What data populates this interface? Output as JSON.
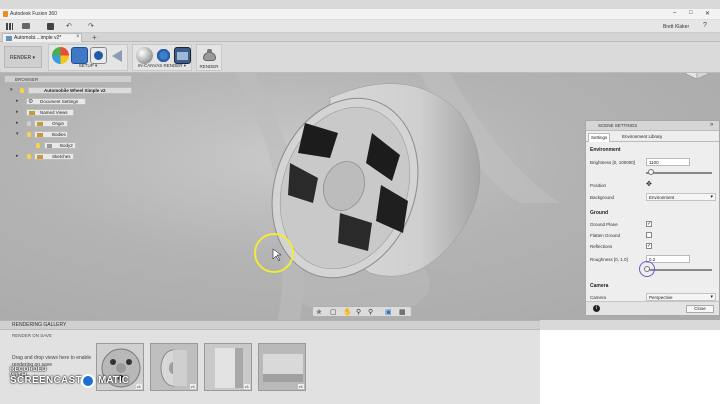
{
  "window": {
    "title": "Autodesk Fusion 360",
    "controls": [
      "–",
      "□",
      "✕"
    ]
  },
  "qat": {
    "grid_icon": "grid-icon",
    "user": "Brett Klaker",
    "help": "?"
  },
  "doc_tab": {
    "label": "Automobi....imple v2*",
    "close": "×",
    "new": "+"
  },
  "toolbar": {
    "mode_label": "RENDER ▾",
    "setup_label": "SETUP ▾",
    "in_canvas_label": "IN-CANVAS RENDER ▾",
    "render_label": "RENDER"
  },
  "browser": {
    "title": "BROWSER",
    "items": [
      {
        "label": "Automobile Wheel Simple v2",
        "level": 0
      },
      {
        "label": "Document Settings",
        "level": 1
      },
      {
        "label": "Named Views",
        "level": 1
      },
      {
        "label": "Origin",
        "level": 1
      },
      {
        "label": "Bodies",
        "level": 1
      },
      {
        "label": "Body2",
        "level": 2
      },
      {
        "label": "Sketches",
        "level": 1
      }
    ]
  },
  "scene_settings": {
    "title": "SCENE SETTINGS",
    "tabs": [
      "Settings",
      "Environment Library"
    ],
    "environment": {
      "section": "Environment",
      "brightness_label": "Brightness [0, 100000]",
      "brightness_value": "1100",
      "brightness_level": 0.05,
      "position_label": "Position",
      "background_label": "Background",
      "background_value": "Environment"
    },
    "ground": {
      "section": "Ground",
      "ground_plane_label": "Ground Plane",
      "ground_plane_checked": true,
      "flatten_ground_label": "Flatten Ground",
      "flatten_ground_checked": false,
      "reflections_label": "Reflections",
      "reflections_checked": true,
      "roughness_label": "Roughness [0, 1.0]",
      "roughness_value": "0.2",
      "roughness_level": 0.2
    },
    "camera": {
      "section": "Camera",
      "camera_label": "Camera",
      "camera_value": "Perspective"
    },
    "close_label": "Close",
    "info": "i"
  },
  "gallery": {
    "title": "RENDERING GALLERY",
    "render_on_save": "RENDER ON SAVE",
    "hint": "Drag and drop views here to enable rendering on save",
    "thumbnails": [
      {
        "badge": "v1"
      },
      {
        "badge": "v1"
      },
      {
        "badge": "v1"
      },
      {
        "badge": "v1"
      }
    ]
  },
  "watermark": {
    "line1": "RECORDED WITH",
    "line2a": "SCREENCAST",
    "line2b": "MATIC"
  },
  "colors": {
    "accent_blue": "#1d6fd1",
    "selection_yellow": "#f3e93a",
    "viewcube_face": "#efefef"
  }
}
